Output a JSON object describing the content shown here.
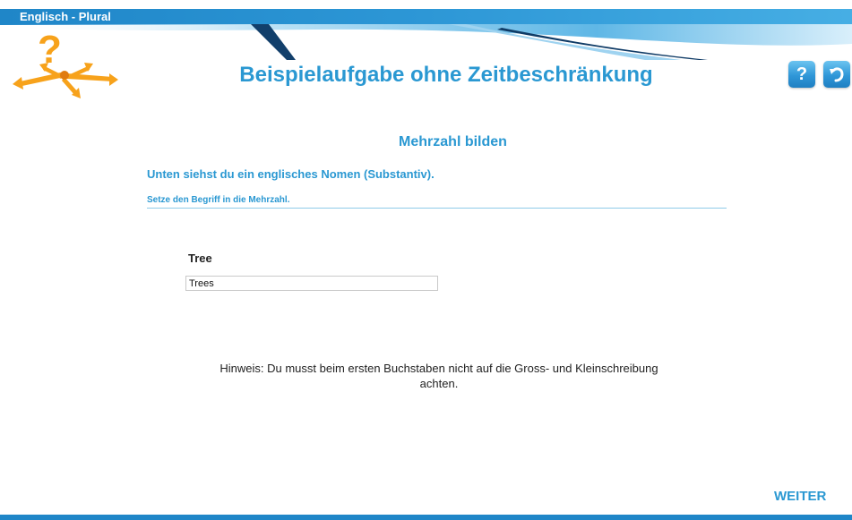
{
  "app": {
    "title": "Englisch - Plural"
  },
  "header": {
    "page_title": "Beispielaufgabe ohne Zeitbeschränkung",
    "help_label": "?",
    "accent_color": "#2a98d2",
    "icons": [
      "question-mark-arrows-logo",
      "help-icon",
      "undo-icon"
    ]
  },
  "exercise": {
    "section_title": "Mehrzahl bilden",
    "instruction_primary": "Unten siehst du ein englisches Nomen (Substantiv).",
    "instruction_secondary": "Setze den Begriff in die Mehrzahl.",
    "term": "Tree",
    "answer_value": "Trees",
    "hint": "Hinweis: Du musst beim ersten Buchstaben nicht auf die Gross- und Kleinschreibung achten."
  },
  "footer": {
    "next_label": "WEITER"
  }
}
